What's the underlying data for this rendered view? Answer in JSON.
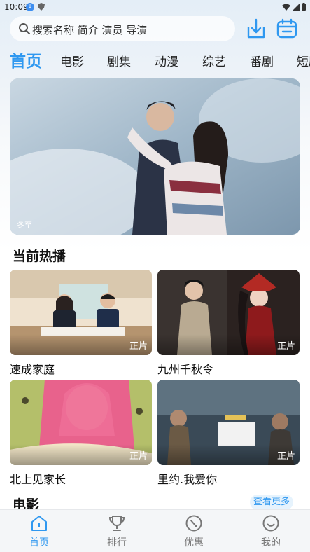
{
  "status_bar": {
    "time": "10:09"
  },
  "search": {
    "placeholder": "搜索名称 简介 演员 导演"
  },
  "tabs": [
    {
      "label": "首页",
      "active": true
    },
    {
      "label": "电影"
    },
    {
      "label": "剧集"
    },
    {
      "label": "动漫"
    },
    {
      "label": "综艺"
    },
    {
      "label": "番剧"
    },
    {
      "label": "短剧"
    }
  ],
  "banner": {
    "caption": "冬至"
  },
  "section_hot": {
    "title": "当前热播",
    "items": [
      {
        "title": "速成家庭",
        "badge": "正片"
      },
      {
        "title": "九州千秋令",
        "badge": "正片"
      },
      {
        "title": "北上见家长",
        "badge": "正片"
      },
      {
        "title": "里约.我爱你",
        "badge": "正片"
      }
    ]
  },
  "section_movie": {
    "title": "电影",
    "more": "查看更多"
  },
  "bottom_nav": [
    {
      "label": "首页",
      "icon": "home-icon",
      "active": true
    },
    {
      "label": "排行",
      "icon": "trophy-icon"
    },
    {
      "label": "优惠",
      "icon": "discount-icon"
    },
    {
      "label": "我的",
      "icon": "profile-icon"
    }
  ],
  "colors": {
    "accent": "#2f98f0",
    "text": "#111111",
    "nav_inactive": "#777777"
  }
}
